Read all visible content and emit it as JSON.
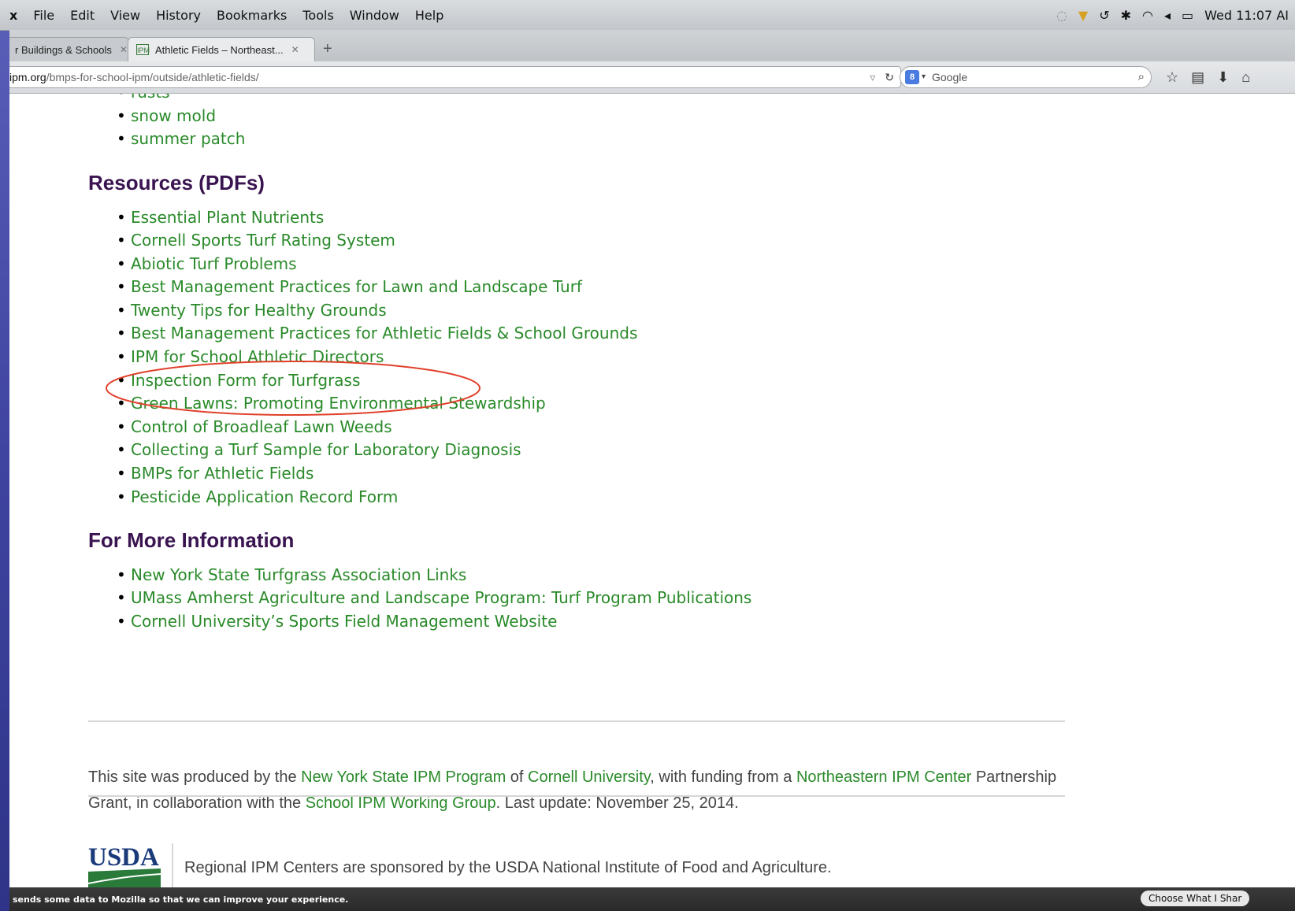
{
  "menubar": {
    "app_name": "x",
    "items": [
      "File",
      "Edit",
      "View",
      "History",
      "Bookmarks",
      "Tools",
      "Window",
      "Help"
    ],
    "clock": "Wed 11:07 AI"
  },
  "tabs": [
    {
      "title": "r Buildings & Schools",
      "active": false
    },
    {
      "title": "Athletic Fields – Northeast...",
      "active": true
    }
  ],
  "nav": {
    "url_domain": "ipm.org",
    "url_path": "/bmps-for-school-ipm/outside/athletic-fields/",
    "search_engine": "Google"
  },
  "page": {
    "top_list": [
      "rusts",
      "snow mold",
      "summer patch"
    ],
    "resources_heading": "Resources (PDFs)",
    "resources": [
      "Essential Plant Nutrients",
      "Cornell Sports Turf Rating System",
      "Abiotic Turf Problems",
      "Best Management Practices for Lawn and Landscape Turf",
      "Twenty Tips for Healthy Grounds",
      "Best Management Practices for Athletic Fields & School Grounds",
      "IPM for School Athletic Directors",
      "Inspection Form for Turfgrass",
      "Green Lawns: Promoting Environmental Stewardship",
      "Control of Broadleaf Lawn Weeds",
      "Collecting a Turf Sample for Laboratory Diagnosis",
      "BMPs for Athletic Fields",
      "Pesticide Application Record Form"
    ],
    "more_info_heading": "For More Information",
    "more_info": [
      "New York State Turfgrass Association Links",
      "UMass Amherst Agriculture and Landscape Program: Turf Program Publications",
      "Cornell University’s Sports Field Management Website"
    ],
    "footer": {
      "t1": "This site was produced by the ",
      "l1": "New York State IPM Program",
      "t2": " of ",
      "l2": "Cornell University",
      "t3": ", with funding from a ",
      "l3": "Northeastern IPM Center",
      "t4": " Partnership Grant, in collaboration with the ",
      "l4": "School IPM Working Group",
      "t5": ". Last update: November 25, 2014."
    },
    "usda_logo_text": "USDA",
    "usda_text": "Regional IPM Centers are sponsored by the USDA National Institute of Food and Agriculture."
  },
  "notification": {
    "message": "sends some data to Mozilla so that we can improve your experience.",
    "button": "Choose What I Shar"
  },
  "colors": {
    "link": "#2a8a2a",
    "heading": "#3a1450",
    "annotation": "#e0402a"
  }
}
